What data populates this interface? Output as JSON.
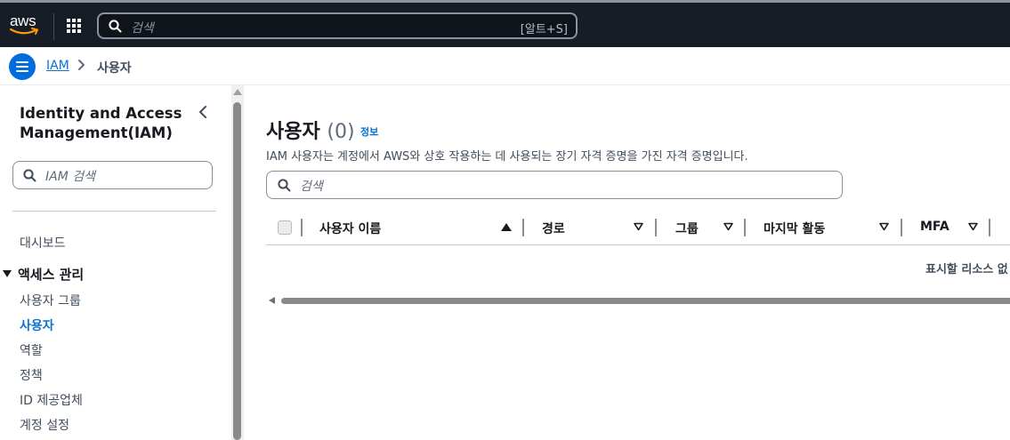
{
  "topnav": {
    "logo_text": "aws",
    "search_placeholder": "검색",
    "search_shortcut": "[알트+S]"
  },
  "breadcrumb": {
    "items": [
      "IAM",
      "사용자"
    ]
  },
  "sidebar": {
    "title": "Identity and Access Management(IAM)",
    "search_placeholder": "IAM 검색",
    "dashboard": "대시보드",
    "section": "액세스 관리",
    "items": [
      "사용자 그룹",
      "사용자",
      "역할",
      "정책",
      "ID 제공업체",
      "계정 설정"
    ],
    "active_item": "사용자"
  },
  "main": {
    "title": "사용자",
    "count": "(0)",
    "info_label": "정보",
    "description": "IAM 사용자는 계정에서 AWS와 상호 작용하는 데 사용되는 장기 자격 증명을 가진 자격 증명입니다.",
    "search_placeholder": "검색",
    "columns": [
      "사용자 이름",
      "경로",
      "그룹",
      "마지막 활동",
      "MFA"
    ],
    "empty_text": "표시할 리소스 없"
  },
  "colors": {
    "topbar_bg": "#161d26",
    "link": "#0972d3",
    "menu_button": "#006ce0"
  }
}
